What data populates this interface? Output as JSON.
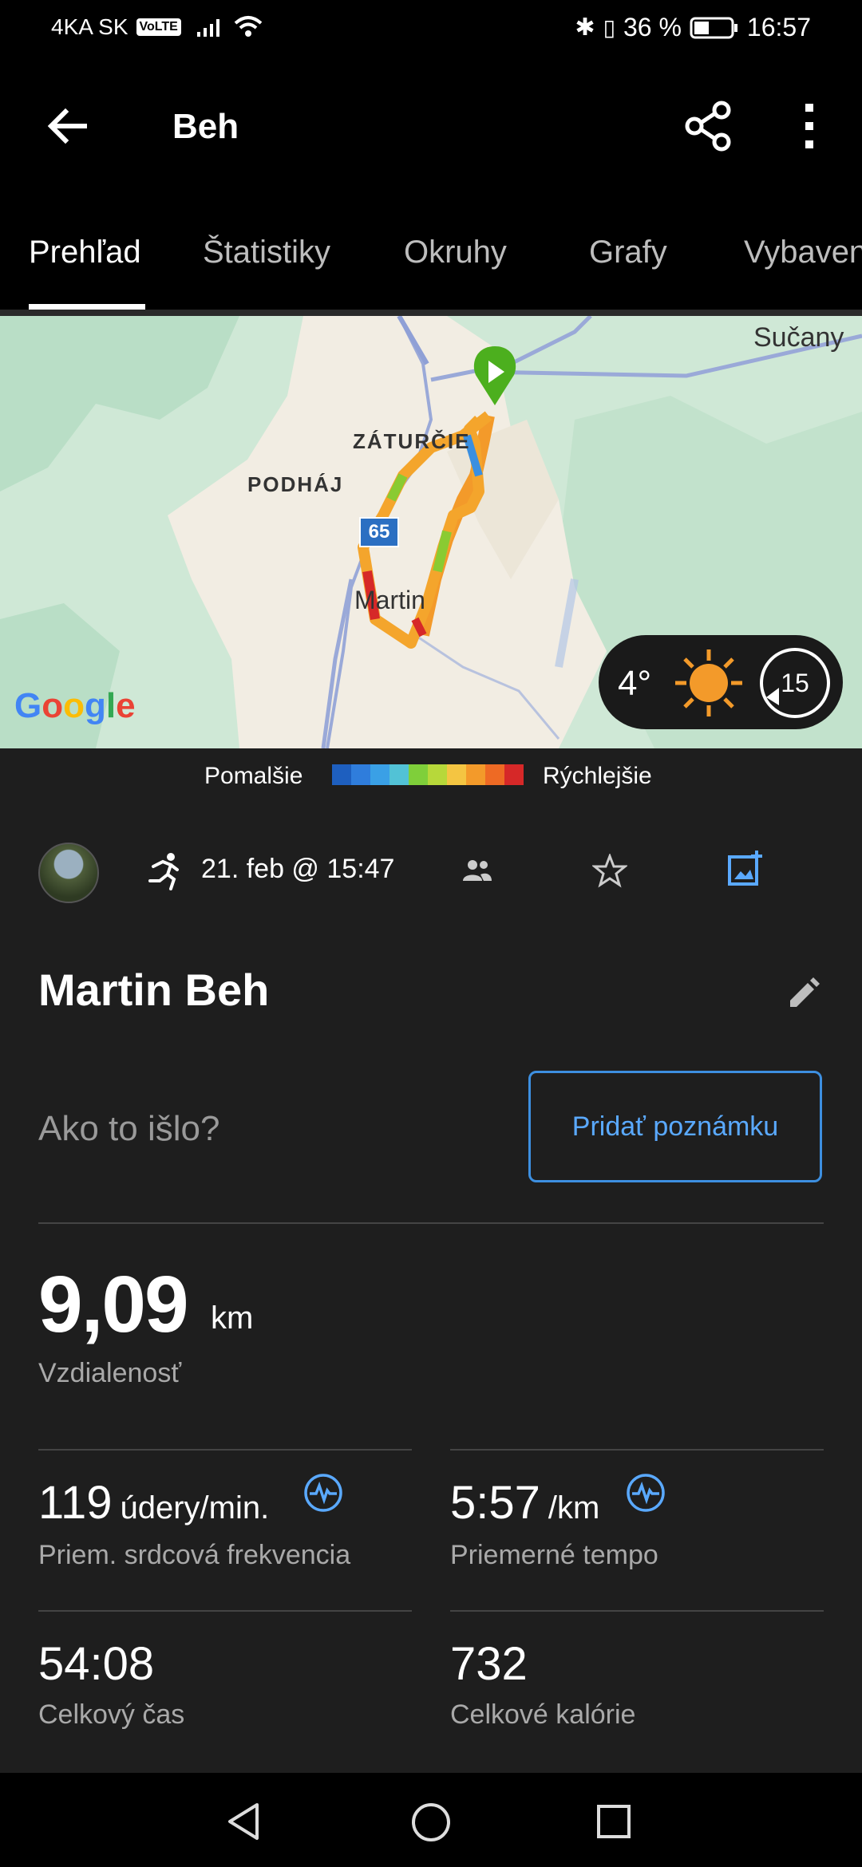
{
  "status_bar": {
    "carrier": "4KA SK",
    "volte": "VoLTE",
    "battery_percent": "36 %",
    "time": "16:57"
  },
  "app_bar": {
    "title": "Beh",
    "icons": [
      "back-arrow-icon",
      "share-icon",
      "more-vert-icon"
    ]
  },
  "tabs": [
    {
      "label": "Prehľad",
      "active": true
    },
    {
      "label": "Štatistiky",
      "active": false
    },
    {
      "label": "Okruhy",
      "active": false
    },
    {
      "label": "Grafy",
      "active": false
    },
    {
      "label": "Vybaven",
      "active": false
    }
  ],
  "map": {
    "labels": {
      "sucany": "Sučany",
      "zaturcie": "ZÁTURČIE",
      "podhaj": "PODHÁJ",
      "martin": "Martin",
      "road_number": "65",
      "google": "Google"
    },
    "weather": {
      "temperature": "4°",
      "wind": "15",
      "icons": [
        "sun-icon",
        "wind-icon"
      ]
    }
  },
  "speed_legend": {
    "slow_label": "Pomalšie",
    "fast_label": "Rýchlejšie",
    "colors": [
      "#1e5fbf",
      "#2f7ddc",
      "#3aa0e6",
      "#52c2d6",
      "#7fcf3a",
      "#b7d83a",
      "#f4c542",
      "#f39a2a",
      "#ee6a24",
      "#d62828"
    ]
  },
  "info_row": {
    "date": "21. feb @ 15:47",
    "icons": [
      "avatar",
      "running-icon",
      "people-icon",
      "star-icon",
      "add-photo-icon"
    ]
  },
  "activity": {
    "title": "Martin Beh",
    "question": "Ako to išlo?",
    "add_note_label": "Pridať poznámku"
  },
  "distance": {
    "value": "9,09",
    "unit": "km",
    "label": "Vzdialenosť"
  },
  "stats": {
    "heart_rate": {
      "value": "119",
      "unit": "údery/min.",
      "label": "Priem. srdcová frekvencia"
    },
    "pace": {
      "value": "5:57",
      "unit": "/km",
      "label": "Priemerné tempo"
    },
    "total_time": {
      "value": "54:08",
      "label": "Celkový čas"
    },
    "calories": {
      "value": "732",
      "label": "Celkové kalórie"
    }
  },
  "colors": {
    "accent_blue": "#5aa9ff",
    "background": "#1e1e1e",
    "start_marker_green": "#4caf1e"
  }
}
